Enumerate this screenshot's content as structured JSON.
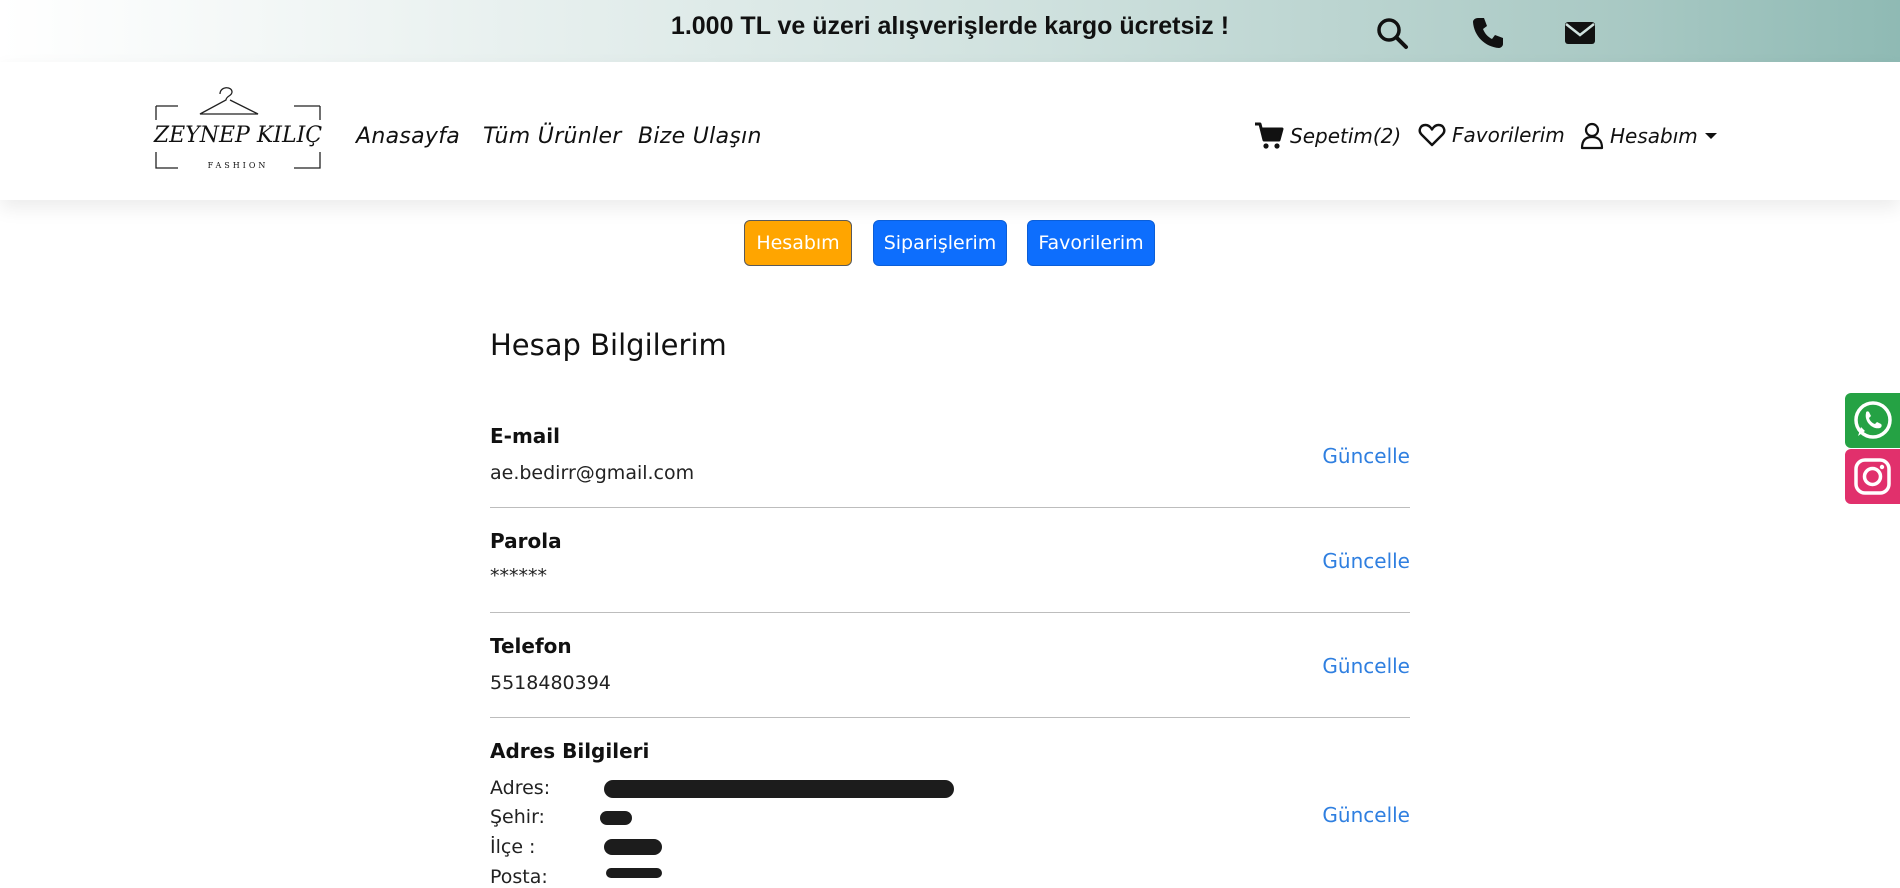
{
  "topbar": {
    "promo_text": "1.000 TL ve üzeri alışverişlerde kargo ücretsiz !",
    "icons": [
      "search-icon",
      "phone-icon",
      "mail-icon"
    ]
  },
  "navbar": {
    "logo_text": "ZEYNEP KILIÇ",
    "logo_subtext": "FASHION",
    "links": [
      "Anasayfa",
      "Tüm Ürünler",
      "Bize Ulaşın"
    ],
    "cart_label": "Sepetim(2)",
    "favorites_label": "Favorilerim",
    "account_label": "Hesabım"
  },
  "tabs": [
    {
      "label": "Hesabım",
      "active": true
    },
    {
      "label": "Siparişlerim",
      "active": false
    },
    {
      "label": "Favorilerim",
      "active": false
    }
  ],
  "main": {
    "title": "Hesap Bilgilerim",
    "fields": [
      {
        "label": "E-mail",
        "value": "ae.bedirr@gmail.com",
        "action": "Güncelle"
      },
      {
        "label": "Parola",
        "value": "******",
        "action": "Güncelle"
      },
      {
        "label": "Telefon",
        "value": "5518480394",
        "action": "Güncelle"
      }
    ],
    "address": {
      "label": "Adres Bilgileri",
      "keys": [
        "Adres:",
        "Şehir:",
        "İlçe :",
        "Posta:"
      ],
      "action": "Güncelle"
    }
  },
  "colors": {
    "active_tab": "#ffa500",
    "primary": "#0d6efd",
    "link": "#2f7fe0",
    "whatsapp": "#25a244",
    "instagram": "#e1306c"
  }
}
